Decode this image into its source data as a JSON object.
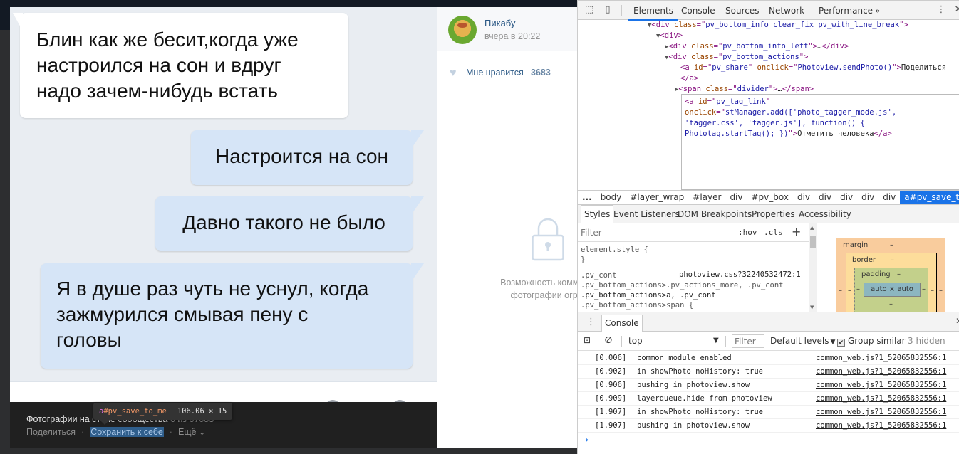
{
  "photo": {
    "messages": [
      {
        "side": "left",
        "style": "white",
        "lines": [
          "Блин как же бесит,когда уже",
          "настроился на сон и вдруг",
          "надо зачем-нибудь встать"
        ]
      },
      {
        "side": "right",
        "style": "blue",
        "lines": [
          "Настроится на сон"
        ]
      },
      {
        "side": "right",
        "style": "blue",
        "lines": [
          "Давно такого не было"
        ]
      },
      {
        "side": "right",
        "style": "blue",
        "lines": [
          "Я в душе раз чуть не уснул, когда",
          "зажмурился смывая пену с",
          "головы"
        ]
      }
    ]
  },
  "info_bar": {
    "title": "Фотографии на стене сообщества",
    "count": "6 из 67083",
    "actions": {
      "share": "Поделиться",
      "save": "Сохранить к себе",
      "more": "Ещё",
      "separator": "·"
    }
  },
  "inspect_tooltip": {
    "tag": "a",
    "id": "#pv_save_to_me",
    "dims": "106.06 × 15"
  },
  "post": {
    "author": "Пикабу",
    "time": "вчера в 20:22",
    "like_label": "Мне нравится",
    "like_count": "3683",
    "restricted_line1": "Возможность комментир",
    "restricted_line2": "фотографии ограни"
  },
  "devtools": {
    "tabs": [
      "Elements",
      "Console",
      "Sources",
      "Network",
      "Performance",
      "»"
    ],
    "active_tab": "Elements",
    "dom": [
      {
        "indent": 0,
        "tri": "▼",
        "parts": [
          [
            "tg",
            "<div "
          ],
          [
            "an",
            "class"
          ],
          [
            "tg",
            "=\""
          ],
          [
            "av",
            "pv_bottom_info clear_fix pv_with_line_break"
          ],
          [
            "tg",
            "\">"
          ]
        ]
      },
      {
        "indent": 1,
        "tri": "▼",
        "parts": [
          [
            "tg",
            "<div>"
          ]
        ]
      },
      {
        "indent": 2,
        "tri": "▶",
        "parts": [
          [
            "tg",
            "<div "
          ],
          [
            "an",
            "class"
          ],
          [
            "tg",
            "=\""
          ],
          [
            "av",
            "pv_bottom_info_left"
          ],
          [
            "tg",
            "\">"
          ],
          [
            "tx",
            "…"
          ],
          [
            "tg",
            "</div>"
          ]
        ]
      },
      {
        "indent": 2,
        "tri": "▼",
        "parts": [
          [
            "tg",
            "<div "
          ],
          [
            "an",
            "class"
          ],
          [
            "tg",
            "=\""
          ],
          [
            "av",
            "pv_bottom_actions"
          ],
          [
            "tg",
            "\">"
          ]
        ]
      },
      {
        "indent": 3,
        "tri": "",
        "parts": [
          [
            "tg",
            "<a "
          ],
          [
            "an",
            "id"
          ],
          [
            "tg",
            "=\""
          ],
          [
            "av",
            "pv_share"
          ],
          [
            "tg",
            "\" "
          ],
          [
            "an",
            "onclick"
          ],
          [
            "tg",
            "=\""
          ],
          [
            "av",
            "Photoview.sendPhoto()"
          ],
          [
            "tg",
            "\">"
          ],
          [
            "tx",
            "Поделиться"
          ]
        ]
      },
      {
        "indent": 3,
        "tri": "",
        "parts": [
          [
            "tg",
            "</a>"
          ]
        ]
      },
      {
        "indent": 3,
        "tri": "▶",
        "parts": [
          [
            "tg",
            "<span "
          ],
          [
            "an",
            "class"
          ],
          [
            "tg",
            "=\""
          ],
          [
            "av",
            "divider"
          ],
          [
            "tg",
            "\">"
          ],
          [
            "tx",
            "…"
          ],
          [
            "tg",
            "</span>"
          ]
        ]
      }
    ],
    "edit_box": [
      [
        [
          "tg",
          "<a "
        ],
        [
          "an",
          "id"
        ],
        [
          "tg",
          "=\""
        ],
        [
          "av",
          "pv_tag_link"
        ],
        [
          "tg",
          "\""
        ]
      ],
      [
        [
          "an",
          "onclick"
        ],
        [
          "tg",
          "=\""
        ],
        [
          "av",
          "stManager.add(['photo_tagger_mode.js',"
        ]
      ],
      [
        [
          "av",
          "'tagger.css', 'tagger.js'], function() {"
        ]
      ],
      [
        [
          "av",
          "Phototag.startTag(); })"
        ],
        [
          "tg",
          "\">"
        ],
        [
          "tx",
          "Отметить человека"
        ],
        [
          "tg",
          "</a>"
        ]
      ]
    ],
    "breadcrumbs": [
      "...",
      "body",
      "#layer_wrap",
      "#layer",
      "div",
      "#pv_box",
      "div",
      "div",
      "div",
      "div",
      "div",
      "a#pv_save_to_me"
    ],
    "subtabs": [
      "Styles",
      "Event Listeners",
      "DOM Breakpoints",
      "Properties",
      "Accessibility"
    ],
    "styles": {
      "filter_placeholder": "Filter",
      "hov": ":hov",
      "cls": ".cls",
      "plus": "+",
      "element_style": "element.style {",
      "element_style_close": "}",
      "rule_source": "photoview.css?32240532472:1",
      "rule_lines": [
        ".pv_cont",
        ".pv_bottom_actions>.pv_actions_more, .pv_cont",
        ".pv_bottom_actions>a, .pv_cont",
        ".pv_bottom_actions>span {"
      ]
    },
    "box_model": {
      "margin_label": "margin",
      "border_label": "border",
      "padding_label": "padding",
      "content": "auto × auto",
      "dash": "–"
    },
    "drawer": {
      "tab": "Console",
      "context": "top",
      "filter_placeholder": "Filter",
      "levels": "Default levels",
      "group_similar": "Group similar",
      "group_similar_checked": true,
      "hidden": "3 hidden"
    },
    "console": [
      {
        "ts": "[0.006]",
        "text": "common module enabled",
        "src": "common_web.js?1_52065832556:1"
      },
      {
        "ts": "[0.902]",
        "text": "in showPhoto noHistory: true",
        "src": "common_web.js?1_52065832556:1"
      },
      {
        "ts": "[0.906]",
        "text": "pushing in photoview.show",
        "src": "common_web.js?1_52065832556:1"
      },
      {
        "ts": "[0.909]",
        "text": "layerqueue.hide from photoview",
        "src": "common_web.js?1_52065832556:1"
      },
      {
        "ts": "[1.907]",
        "text": "in showPhoto noHistory: true",
        "src": "common_web.js?1_52065832556:1"
      },
      {
        "ts": "[1.907]",
        "text": "pushing in photoview.show",
        "src": "common_web.js?1_52065832556:1"
      }
    ],
    "prompt": "›"
  }
}
